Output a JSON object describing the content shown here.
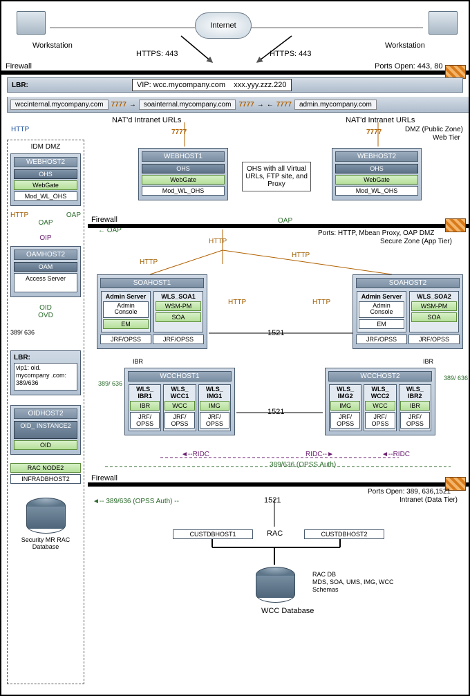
{
  "internet": "Internet",
  "workstation_left": "Workstation",
  "workstation_right": "Workstation",
  "https_left": "HTTPS: 443",
  "https_right": "HTTPS: 443",
  "firewall1_label": "Firewall",
  "firewall1_ports": "Ports Open: 443, 80",
  "lbr_label": "LBR:",
  "vip_host": "VIP: wcc.mycompany.com",
  "vip_ip": "xxx.yyy.zzz.220",
  "nat": {
    "wcc": "wccinternal.mycompany.com",
    "soa": "soainternal.mycompany.com",
    "admin": "admin.mycompany.com"
  },
  "nat_port": "7777",
  "nat_label_left": "NAT'd Intranet URLs",
  "nat_label_right": "NAT'd Intranet URLs",
  "dmz_label1": "DMZ (Public Zone)",
  "dmz_label2": "Web Tier",
  "http_label": "HTTP",
  "oap_label": "OAP",
  "oip_label": "OIP",
  "idm_dmz": {
    "title": "IDM DMZ",
    "webhost2": {
      "name": "WEBHOST2",
      "ohs": "OHS",
      "webgate": "WebGate",
      "mod": "Mod_WL_OHS"
    },
    "oamhost2": {
      "name": "OAMHOST2",
      "oam": "OAM",
      "access": "Access Server"
    },
    "oid_label": "OID",
    "ovd_label": "OVD",
    "port_389_636": "389/ 636",
    "lbr": {
      "title": "LBR:",
      "vip": "vip1: oid. mycompany .com: 389/636"
    },
    "oidhost2": {
      "name": "OIDHOST2",
      "inst": "OID_ INSTANCE2",
      "oid": "OID"
    },
    "racnode2": "RAC NODE2",
    "infradbhost2": "INFRADBHOST2",
    "security_db": "Security MR RAC Database"
  },
  "webhost1": {
    "name": "WEBHOST1",
    "ohs": "OHS",
    "webgate": "WebGate",
    "mod": "Mod_WL_OHS"
  },
  "webhost2": {
    "name": "WEBHOST2",
    "ohs": "OHS",
    "webgate": "WebGate",
    "mod": "Mod_WL_OHS"
  },
  "ohs_note": "OHS with all Virtual URLs, FTP site, and Proxy",
  "firewall2_label": "Firewall",
  "firewall2_ports": "Ports: HTTP, Mbean Proxy, OAP DMZ",
  "firewall2_zone": "Secure Zone (App Tier)",
  "soahost1": {
    "name": "SOAHOST1",
    "admin": {
      "title": "Admin Server",
      "console": "Admin Console",
      "em": "EM"
    },
    "wls": {
      "title": "WLS_SOA1",
      "wsm": "WSM-PM",
      "soa": "SOA"
    },
    "jrf1": "JRF/OPSS",
    "jrf2": "JRF/OPSS"
  },
  "soahost2": {
    "name": "SOAHOST2",
    "admin": {
      "title": "Admin Server",
      "console": "Admin Console",
      "em": "EM"
    },
    "wls": {
      "title": "WLS_SOA2",
      "wsm": "WSM-PM",
      "soa": "SOA"
    },
    "jrf1": "JRF/OPSS",
    "jrf2": "JRF/OPSS"
  },
  "port_1521": "1521",
  "ibr_label": "IBR",
  "port_389_636_right": "389/ 636",
  "wcchost1": {
    "name": "WCCHOST1",
    "c1": {
      "title": "WLS_ IBR1",
      "svc": "IBR"
    },
    "c2": {
      "title": "WLS_ WCC1",
      "svc": "WCC"
    },
    "c3": {
      "title": "WLS_ IMG1",
      "svc": "IMG"
    },
    "jrf": "JRF/ OPSS"
  },
  "wcchost2": {
    "name": "WCCHOST2",
    "c1": {
      "title": "WLS_ IMG2",
      "svc": "IMG"
    },
    "c2": {
      "title": "WLS_ WCC2",
      "svc": "WCC"
    },
    "c3": {
      "title": "WLS_ IBR2",
      "svc": "IBR"
    },
    "jrf": "JRF/ OPSS"
  },
  "ridc_label": "RIDC",
  "opss_auth": "389/636 (OPSS Auth)",
  "firewall3_label": "Firewall",
  "firewall3_ports": "Ports Open: 389, 636,1521",
  "firewall3_zone": "Intranet (Data Tier)",
  "custdbhost1": "CUSTDBHOST1",
  "custdbhost2": "CUSTDBHOST2",
  "rac_label": "RAC",
  "wcc_db": "WCC Database",
  "rac_schemas_1": "RAC DB",
  "rac_schemas_2": "MDS, SOA, UMS, IMG, WCC",
  "rac_schemas_3": "Schemas"
}
